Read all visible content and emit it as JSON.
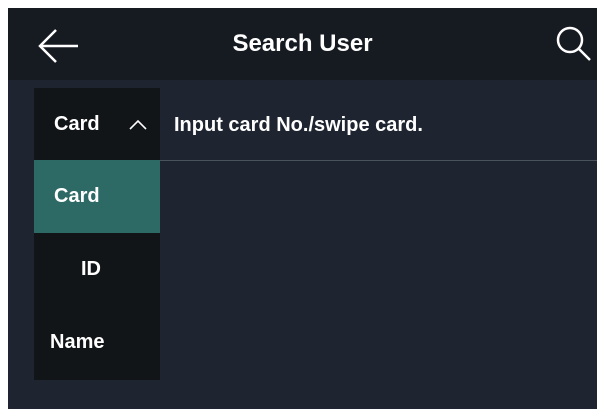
{
  "header": {
    "title": "Search User",
    "back_icon": "back-arrow-icon",
    "search_icon": "search-icon"
  },
  "search": {
    "type_selected": "Card",
    "placeholder": "Input card No./swipe card.",
    "value": ""
  },
  "dropdown": {
    "expanded": true,
    "options": [
      {
        "label": "Card",
        "selected": true
      },
      {
        "label": "ID",
        "selected": false
      },
      {
        "label": "Name",
        "selected": false
      }
    ]
  },
  "colors": {
    "background": "#1e2530",
    "header": "#161b22",
    "dropdown": "#121518",
    "selected": "#2d6a66",
    "text": "#ffffff"
  }
}
